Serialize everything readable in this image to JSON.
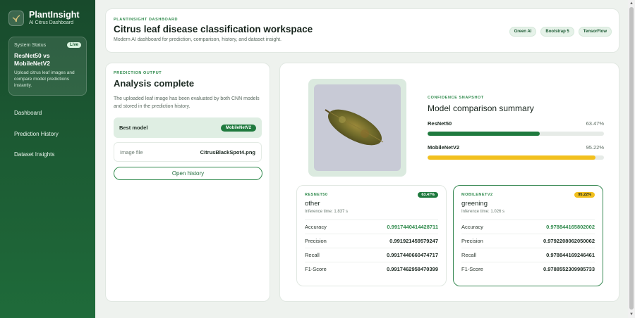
{
  "sidebar": {
    "brand_title": "PlantInsight",
    "brand_subtitle": "AI Citrus Dashboard",
    "status_label": "System Status",
    "status_badge": "Live",
    "status_title": "ResNet50 vs MobileNetV2",
    "status_desc": "Upload citrus leaf images and compare model predictions instantly.",
    "nav": [
      {
        "label": "Dashboard",
        "icon": "none"
      },
      {
        "label": "Prediction History",
        "icon": "none"
      },
      {
        "label": "Dataset Insights",
        "icon": "none"
      }
    ]
  },
  "header": {
    "eyebrow": "PLANTINSIGHT DASHBOARD",
    "title": "Citrus leaf disease classification workspace",
    "subtitle": "Modern AI dashboard for prediction, comparison, history, and dataset insight.",
    "chips": [
      "Green AI",
      "Bootstrap 5",
      "TensorFlow"
    ]
  },
  "prediction": {
    "eyebrow": "PREDICTION OUTPUT",
    "title": "Analysis complete",
    "desc": "The uploaded leaf image has been evaluated by both CNN models and stored in the prediction history.",
    "best_label": "Best model",
    "best_value": "MobileNetV2",
    "file_label": "Image file",
    "file_value": "CitrusBlackSpot4.png",
    "history_button": "Open history"
  },
  "snapshot": {
    "eyebrow": "CONFIDENCE SNAPSHOT",
    "title": "Model comparison summary",
    "models": [
      {
        "name": "ResNet50",
        "pct": "63.47%",
        "fraction": 0.6347,
        "color": "#1f7a3e"
      },
      {
        "name": "MobileNetV2",
        "pct": "95.22%",
        "fraction": 0.9522,
        "color": "#f2c01e"
      }
    ]
  },
  "cards": [
    {
      "eyebrow": "RESNET50",
      "badge": "63.47%",
      "badge_bg": "#1f7a3e",
      "badge_fg": "#ffffff",
      "prediction": "other",
      "time": "Inference time: 1.837 s",
      "metrics": [
        {
          "k": "Accuracy",
          "v": "0.9917440414428711"
        },
        {
          "k": "Precision",
          "v": "0.991921459579247"
        },
        {
          "k": "Recall",
          "v": "0.9917440660474717"
        },
        {
          "k": "F1-Score",
          "v": "0.9917462958470399"
        }
      ]
    },
    {
      "eyebrow": "MOBILENETV2",
      "badge": "95.22%",
      "badge_bg": "#f2c01e",
      "badge_fg": "#1c2a22",
      "prediction": "greening",
      "time": "Inference time: 1.026 s",
      "metrics": [
        {
          "k": "Accuracy",
          "v": "0.978844165802002"
        },
        {
          "k": "Precision",
          "v": "0.9792208062050062"
        },
        {
          "k": "Recall",
          "v": "0.978844169246461"
        },
        {
          "k": "F1-Score",
          "v": "0.9788552309985733"
        }
      ]
    }
  ]
}
